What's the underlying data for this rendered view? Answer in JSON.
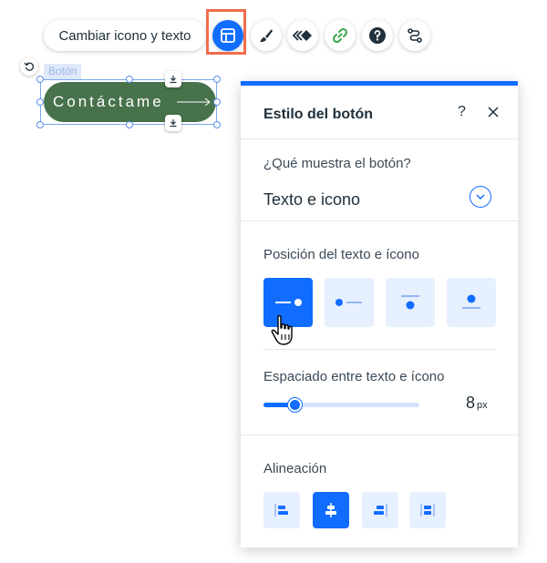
{
  "toolbar": {
    "change_label": "Cambiar icono y texto",
    "buttons": [
      {
        "name": "layout-icon",
        "selected": true
      },
      {
        "name": "paintbrush-icon"
      },
      {
        "name": "animation-icon"
      },
      {
        "name": "link-icon"
      },
      {
        "name": "help-icon"
      },
      {
        "name": "connect-icon"
      }
    ]
  },
  "canvas": {
    "element_tag": "Botón",
    "button_text": "Contáctame",
    "button_color": "#47724b"
  },
  "panel": {
    "title": "Estilo del botón",
    "help_symbol": "?",
    "display": {
      "label": "¿Qué muestra el botón?",
      "value": "Texto e icono"
    },
    "position": {
      "label": "Posición del texto e ícono",
      "options": [
        "text-left-icon-right",
        "icon-left-text-right",
        "text-top-icon-bottom",
        "icon-top-text-bottom"
      ],
      "selected_index": 0
    },
    "spacing": {
      "label": "Espaciado entre texto e ícono",
      "value": "8",
      "unit": "px",
      "level": 0.2
    },
    "alignment": {
      "label": "Alineación",
      "options": [
        "left",
        "center",
        "right",
        "justify"
      ],
      "selected_index": 1
    }
  },
  "colors": {
    "accent": "#116dff",
    "accent_light": "#e7f0ff",
    "highlight_frame": "#f26d4d"
  }
}
